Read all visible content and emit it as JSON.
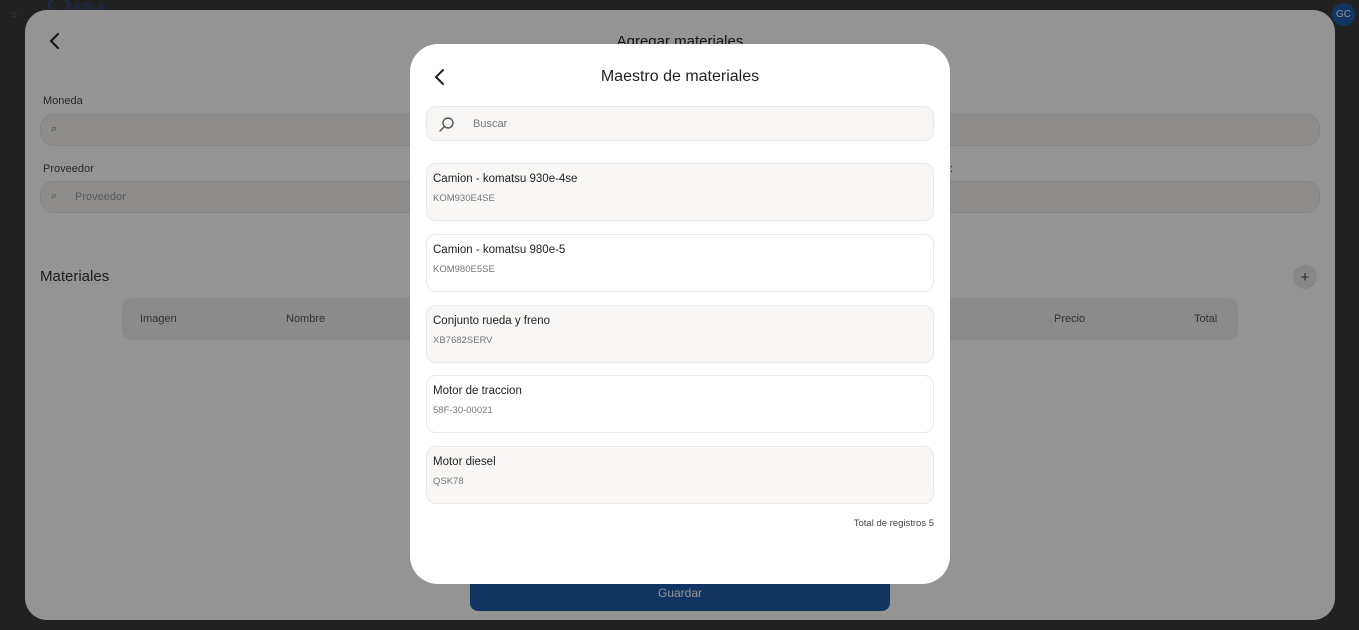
{
  "app": {
    "logo_text": "STLA",
    "avatar_initials": "GC",
    "brand_color": "#1f5aa6"
  },
  "background_form": {
    "title": "Agregar materiales",
    "currency_label": "Moneda",
    "currency_placeholder": "",
    "supplier_label": "Proveedor",
    "supplier_placeholder": "Proveedor",
    "right_label_fragment": ":",
    "materials_section": "Materiales",
    "table_headers": [
      "Imagen",
      "Nombre",
      "Precio",
      "Total"
    ],
    "save_label": "Guardar"
  },
  "modal": {
    "title": "Maestro de materiales",
    "search_placeholder": "Buscar",
    "items": [
      {
        "name": "Camion - komatsu 930e-4se",
        "code": "KOM930E4SE"
      },
      {
        "name": "Camion - komatsu 980e-5",
        "code": "KOM980E5SE"
      },
      {
        "name": "Conjunto rueda y freno",
        "code": "XB7682SERV"
      },
      {
        "name": "Motor de traccion",
        "code": "58F-30-00021"
      },
      {
        "name": "Motor diesel",
        "code": "QSK78"
      }
    ],
    "total_text": "Total de registros 5"
  }
}
